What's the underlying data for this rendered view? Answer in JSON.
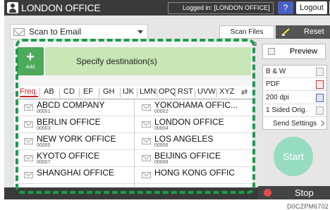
{
  "topbar": {
    "title": "LONDON OFFICE",
    "login_text": "Logged in: [LONDON OFFICE]",
    "help_label": "?",
    "logout_label": "Logout"
  },
  "toolbar": {
    "scan_to_email": "Scan to Email",
    "scan_files_status": "Scan Files Status",
    "reset_label": "Reset"
  },
  "destination": {
    "add_label": "Add",
    "add_symbol": "+",
    "specify_label": "Specify destination(s)"
  },
  "tabs": [
    "Freq.",
    "AB",
    "CD",
    "EF",
    "GH",
    "IJK",
    "LMN",
    "OPQ",
    "RST",
    "UVW",
    "XYZ"
  ],
  "active_tab": "Freq.",
  "entries": [
    {
      "name": "ABCD COMPANY",
      "num": "00001"
    },
    {
      "name": "YOKOHAMA OFFIC...",
      "num": "00002"
    },
    {
      "name": "BERLIN OFFICE",
      "num": "00003"
    },
    {
      "name": "LONDON OFFICE",
      "num": "00004"
    },
    {
      "name": "NEW YORK OFFICE",
      "num": "00005"
    },
    {
      "name": "LOS ANGELES",
      "num": "00006"
    },
    {
      "name": "KYOTO OFFICE",
      "num": "00007"
    },
    {
      "name": "BEIJING OFFICE",
      "num": "00008"
    },
    {
      "name": "SHANGHAI OFFICE",
      "num": ""
    },
    {
      "name": "HONG KONG OFFIC",
      "num": ""
    }
  ],
  "right": {
    "preview_label": "Preview",
    "color_mode": "B & W",
    "file_type": "PDF",
    "resolution": "200 dpi",
    "sides": "1 Sided Orig.",
    "send_settings": "Send Settings",
    "start_label": "Start"
  },
  "bottom": {
    "stop_label": "Stop"
  },
  "footer_code": "D0CZPM6702",
  "colors": {
    "accent_green": "#1a9e4a",
    "add_green": "#4caa5a",
    "specify_bg": "#c8e6b6",
    "active_tab": "#d32121",
    "start": "#96dcc0",
    "help": "#4a5fc4"
  }
}
